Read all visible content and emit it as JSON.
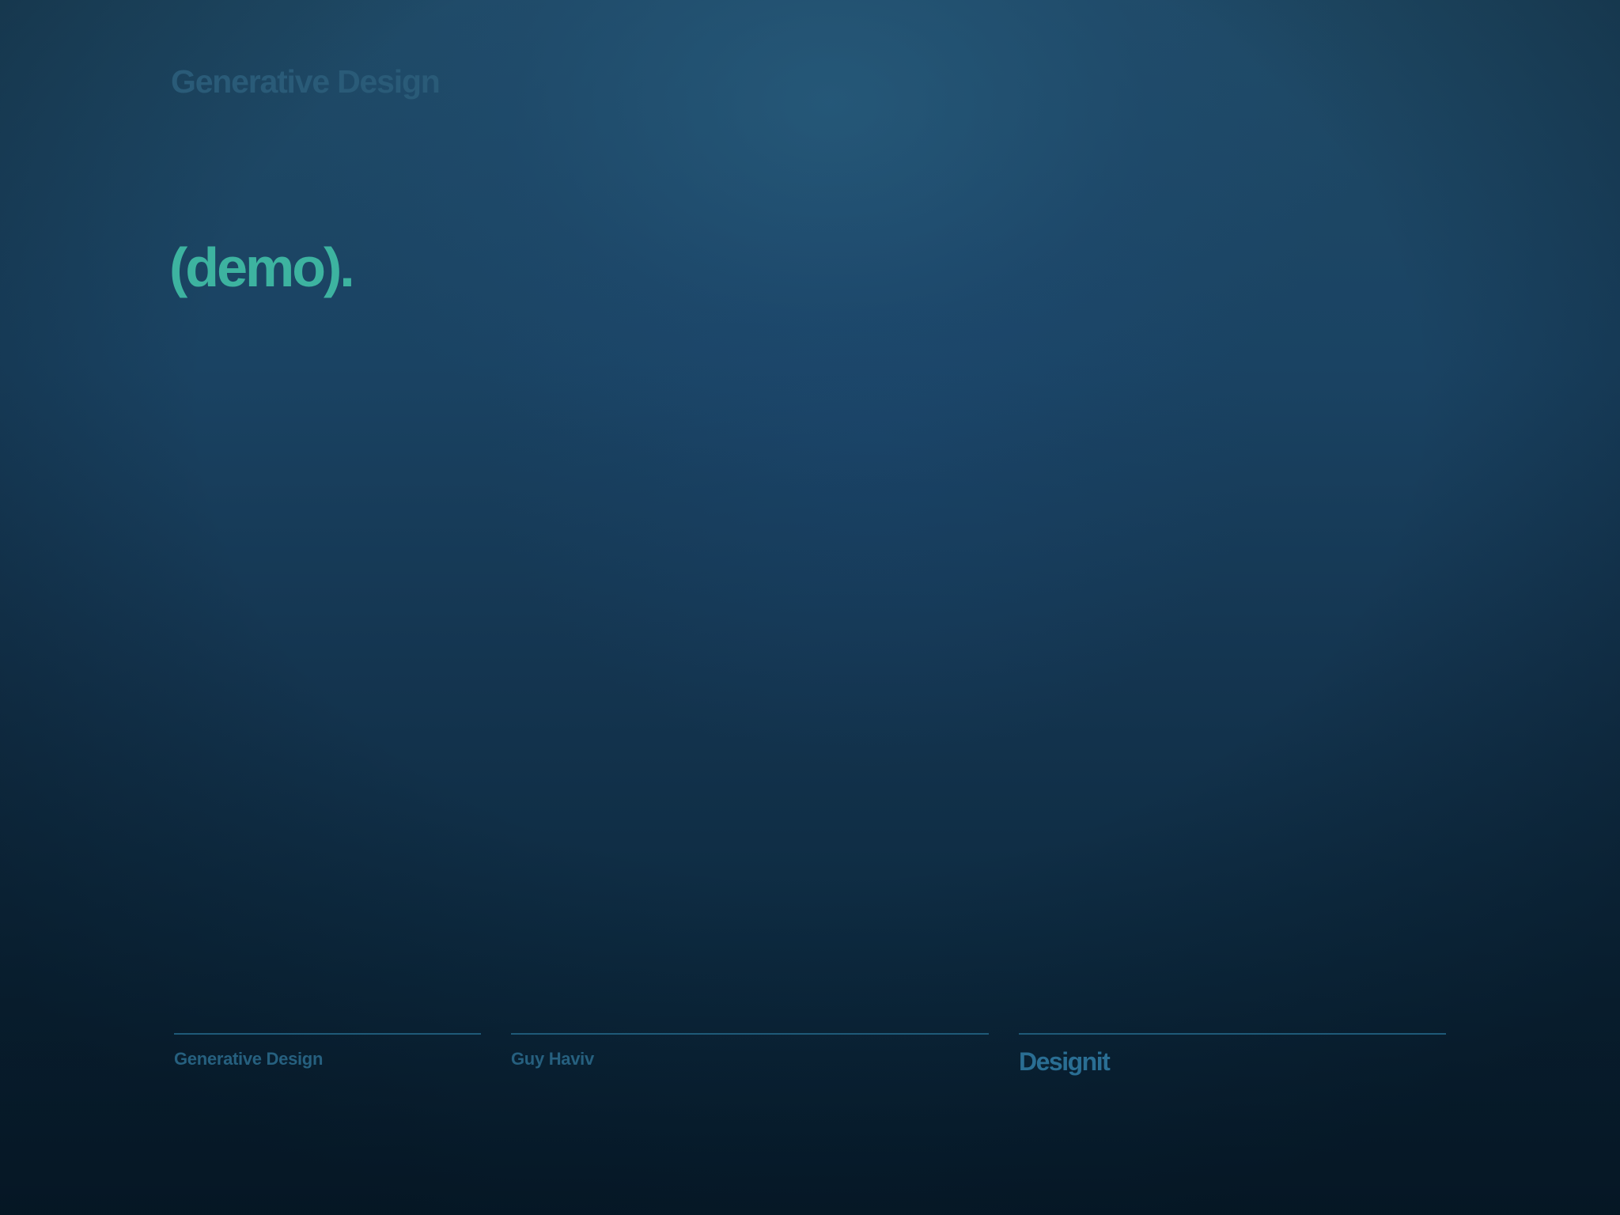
{
  "header": {
    "title": "Generative Design"
  },
  "main": {
    "heading": "(demo)."
  },
  "footer": {
    "left_text": "Generative Design",
    "center_text": "Guy Haviv",
    "brand_logo": "Designit"
  },
  "colors": {
    "accent": "#3db3a0",
    "muted_text": "#2a5b78",
    "divider": "#1f5a78",
    "background_top": "#1f4a66",
    "background_bottom": "#071d2e"
  }
}
